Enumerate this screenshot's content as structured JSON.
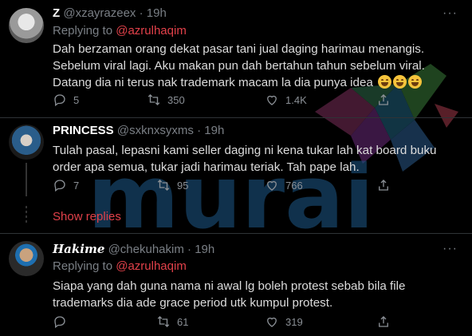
{
  "tweets": [
    {
      "name": "Z",
      "handle": "@xzayrazeex",
      "dot": "·",
      "time": "19h",
      "replying_prefix": "Replying to",
      "replying_to": "@azrulhaqim",
      "lines": [
        "Dah berzaman orang dekat pasar tani jual daging harimau menangis.",
        "Sebelum viral lagi. Aku makan pun dah bertahun tahun sebelum viral.",
        "Datang dia ni terus nak trademark macam la dia punya idea"
      ],
      "emoji": "face-with-tears-of-joy-emoji",
      "counts": {
        "reply": "5",
        "retweet": "350",
        "like": "1.4K"
      }
    },
    {
      "name": "PRINCESS",
      "handle": "@sxknxsyxms",
      "dot": "·",
      "time": "19h",
      "lines": [
        "Tulah pasal, lepasni kami seller daging ni kena tukar lah kat board buku",
        "order apa semua, tukar jadi harimau teriak. Tah pape lah."
      ],
      "counts": {
        "reply": "7",
        "retweet": "95",
        "like": "766"
      }
    },
    {
      "name": "𝑯𝒂𝒌𝒊𝒎𝒆",
      "handle": "@chekuhakim",
      "dot": "·",
      "time": "19h",
      "replying_prefix": "Replying to",
      "replying_to": "@azrulhaqim",
      "lines": [
        "Siapa yang dah guna nama ni awal lg boleh protest sebab bila file",
        "trademarks dia ade grace period utk kumpul protest."
      ],
      "counts": {
        "retweet": "61",
        "like": "319"
      }
    }
  ],
  "show_replies": "Show replies",
  "more_label": "···",
  "watermark": "murai",
  "colors": {
    "accent": "#e2414a",
    "background": "#000000",
    "muted": "#7a7f85"
  }
}
